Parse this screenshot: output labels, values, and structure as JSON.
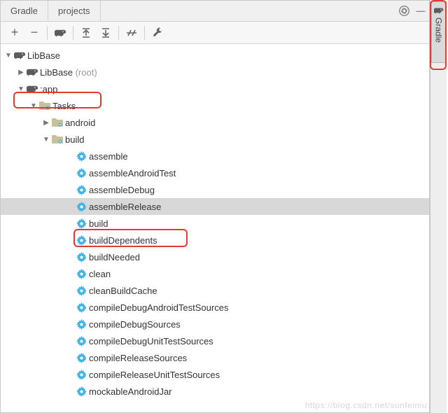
{
  "tabs": {
    "gradle": "Gradle",
    "projects": "projects",
    "side_button": "Gradle"
  },
  "toolbar": {
    "add": "+",
    "remove": "−",
    "run": "▶",
    "expand": "⇱",
    "collapse": "⇲",
    "divider": "//",
    "wrench": "✎"
  },
  "tree": {
    "root": {
      "label": "LibBase"
    },
    "lib_base": {
      "label": "LibBase",
      "suffix": "(root)"
    },
    "app": {
      "label": ":app"
    },
    "tasks": {
      "label": "Tasks"
    },
    "android": {
      "label": "android"
    },
    "build": {
      "label": "build"
    },
    "buildTasks": [
      "assemble",
      "assembleAndroidTest",
      "assembleDebug",
      "assembleRelease",
      "build",
      "buildDependents",
      "buildNeeded",
      "clean",
      "cleanBuildCache",
      "compileDebugAndroidTestSources",
      "compileDebugSources",
      "compileDebugUnitTestSources",
      "compileReleaseSources",
      "compileReleaseUnitTestSources",
      "mockableAndroidJar"
    ]
  },
  "selected_task_index": 3,
  "watermark": "https://blog.csdn.net/sunfeiniu"
}
